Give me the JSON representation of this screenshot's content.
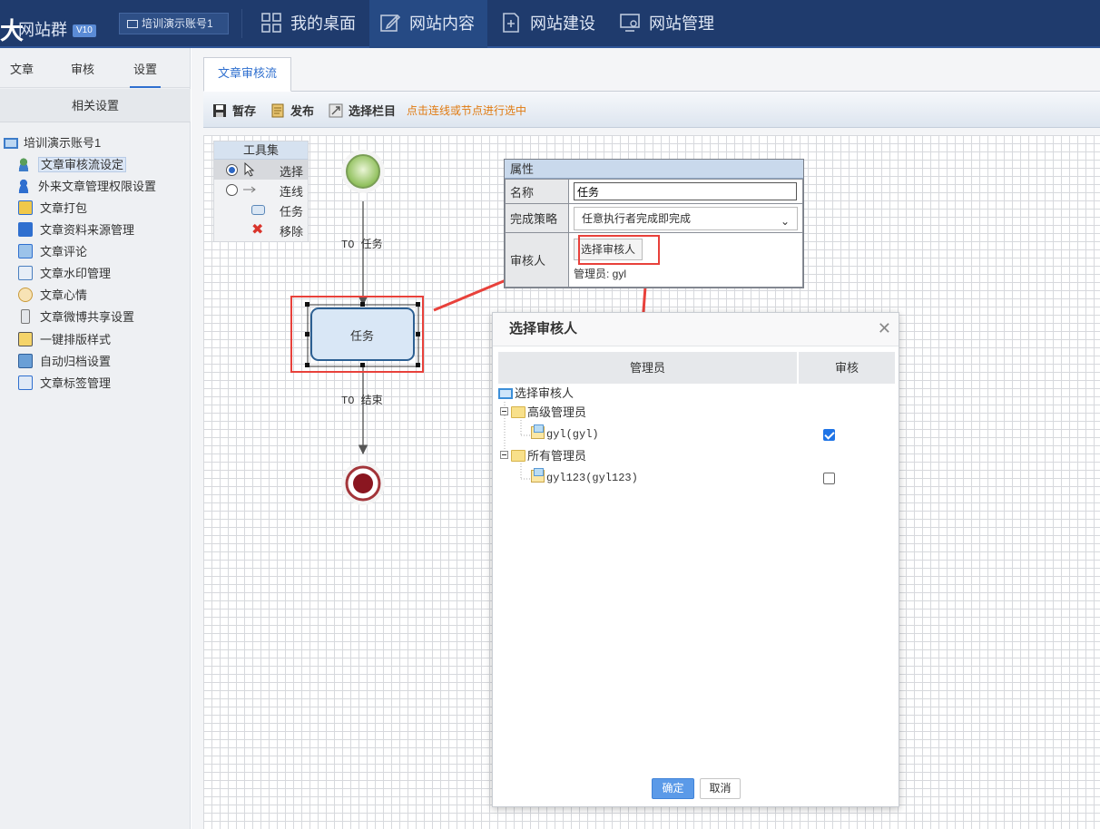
{
  "app": {
    "logo_mark": "大",
    "logo_text": "网站群",
    "version_badge": "V10",
    "account": "培训演示账号1"
  },
  "topnav": [
    {
      "label": "我的桌面"
    },
    {
      "label": "网站内容"
    },
    {
      "label": "网站建设"
    },
    {
      "label": "网站管理"
    }
  ],
  "sidebar": {
    "tabs": [
      "文章",
      "审核",
      "设置"
    ],
    "section": "相关设置",
    "root": "培训演示账号1",
    "items": [
      {
        "label": "文章审核流设定"
      },
      {
        "label": "外来文章管理权限设置"
      },
      {
        "label": "文章打包"
      },
      {
        "label": "文章资料来源管理"
      },
      {
        "label": "文章评论"
      },
      {
        "label": "文章水印管理"
      },
      {
        "label": "文章心情"
      },
      {
        "label": "文章微博共享设置"
      },
      {
        "label": "一键排版样式"
      },
      {
        "label": "自动归档设置"
      },
      {
        "label": "文章标签管理"
      }
    ]
  },
  "tab": {
    "label": "文章审核流"
  },
  "toolbar": {
    "save_label": "暂存",
    "publish_label": "发布",
    "column_label": "选择栏目",
    "hint": "点击连线或节点进行选中"
  },
  "toolbox": {
    "title": "工具集",
    "tools": [
      {
        "label": "选择",
        "selected": true
      },
      {
        "label": "连线",
        "selected": false
      },
      {
        "label": "任务"
      },
      {
        "label": "移除"
      }
    ]
  },
  "flow": {
    "edge1": "TO 任务",
    "task": "任务",
    "edge2": "TO 结束"
  },
  "properties": {
    "title": "属性",
    "name_label": "名称",
    "name_value": "任务",
    "strategy_label": "完成策略",
    "strategy_value": "任意执行者完成即完成",
    "reviewer_label": "审核人",
    "pick_button": "选择审核人",
    "reviewer_value": "管理员: gyl"
  },
  "dialog": {
    "title": "选择审核人",
    "col_admin": "管理员",
    "col_review": "审核",
    "tree_root": "选择审核人",
    "groups": [
      {
        "label": "高级管理员",
        "members": [
          {
            "label": "gyl(gyl)",
            "checked": true
          }
        ]
      },
      {
        "label": "所有管理员",
        "members": [
          {
            "label": "gyl123(gyl123)",
            "checked": false
          }
        ]
      }
    ],
    "confirm": "确定",
    "cancel": "取消"
  },
  "colors": {
    "nav_bg": "#1f3b6d",
    "accent": "#2f6fcf",
    "annotation_red": "#e8413b",
    "hint_orange": "#e07a10"
  }
}
